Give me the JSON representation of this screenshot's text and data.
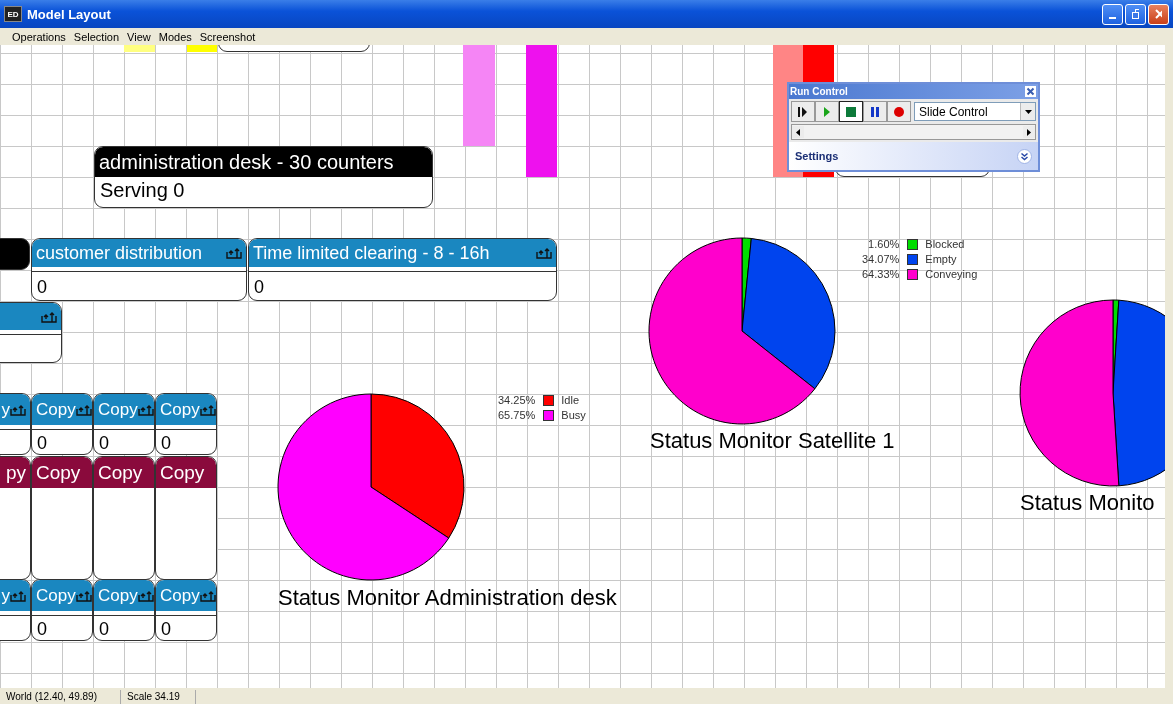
{
  "window": {
    "title": "Model Layout",
    "icon_text": "ED"
  },
  "menu": [
    "Operations",
    "Selection",
    "View",
    "Modes",
    "Screenshot"
  ],
  "bars": [
    {
      "color": "#ffff80"
    },
    {
      "color": "#ffff00"
    },
    {
      "color": "#f585f5"
    },
    {
      "color": "#ee11ee"
    },
    {
      "color": "#ff8585"
    },
    {
      "color": "#ff0000"
    }
  ],
  "blocks": [
    {
      "header": "administration desk - 30 counters",
      "color": "#000000",
      "value": "Serving 0"
    },
    {
      "color": "#000000"
    },
    {
      "header": "customer distribution",
      "color": "#1a87c0",
      "icon": true,
      "value": "0"
    },
    {
      "header": "Time limited clearing - 8 - 16h",
      "color": "#1a87c0",
      "icon": true,
      "value": "0"
    },
    {
      "color": "#1a87c0",
      "icon": true
    },
    {
      "header": "y",
      "color": "#1a87c0",
      "icon": true
    },
    {
      "header": "Copy",
      "color": "#1a87c0",
      "icon": true,
      "value": "0"
    },
    {
      "header": "Copy",
      "color": "#1a87c0",
      "icon": true,
      "value": "0"
    },
    {
      "header": "Copy",
      "color": "#1a87c0",
      "icon": true,
      "value": "0"
    },
    {
      "header": "py",
      "color": "#8a0a3c"
    },
    {
      "header": "Copy",
      "color": "#8a0a3c"
    },
    {
      "header": "Copy",
      "color": "#8a0a3c"
    },
    {
      "header": "Copy",
      "color": "#8a0a3c"
    },
    {
      "header": "y",
      "color": "#1a87c0",
      "icon": true
    },
    {
      "header": "Copy",
      "color": "#1a87c0",
      "icon": true,
      "value": "0"
    },
    {
      "header": "Copy",
      "color": "#1a87c0",
      "icon": true,
      "value": "0"
    },
    {
      "header": "Copy",
      "color": "#1a87c0",
      "icon": true,
      "value": "0"
    }
  ],
  "monitors": [
    {
      "chart_data": {
        "type": "pie",
        "title": "Status Monitor Administration desk",
        "categories": [
          "Idle",
          "Busy"
        ],
        "values": [
          34.25,
          65.75
        ],
        "value_labels": [
          "34.25%",
          "65.75%"
        ],
        "colors": [
          "#ff0000",
          "#ff00ff"
        ]
      }
    },
    {
      "chart_data": {
        "type": "pie",
        "title": "Status Monitor Satellite 1",
        "categories": [
          "Blocked",
          "Empty",
          "Conveying"
        ],
        "values": [
          1.6,
          34.07,
          64.33
        ],
        "value_labels": [
          "1.60%",
          "34.07%",
          "64.33%"
        ],
        "colors": [
          "#00dd00",
          "#0044ee",
          "#ff00cc"
        ]
      }
    },
    {
      "title": "Status Monito"
    }
  ],
  "run_control": {
    "title": "Run Control",
    "buttons": [
      {
        "kind": "step",
        "selected": false
      },
      {
        "kind": "play",
        "selected": false
      },
      {
        "kind": "stop",
        "selected": true
      },
      {
        "kind": "pause",
        "selected": false
      },
      {
        "kind": "record",
        "selected": false
      }
    ],
    "mode": "Slide Control",
    "settings": "Settings"
  },
  "status_bar": [
    "World (12.40, 49.89)",
    "Scale 34.19"
  ]
}
